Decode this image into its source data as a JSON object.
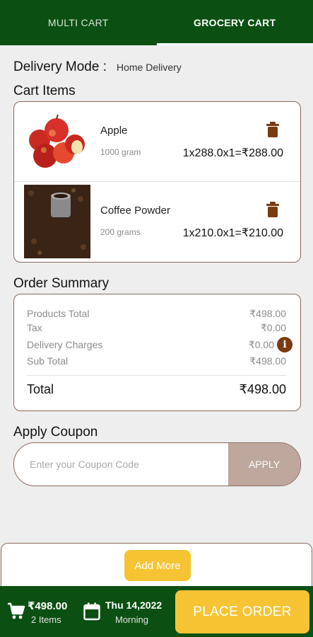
{
  "tabs": [
    {
      "label": "MULTI CART",
      "active": false
    },
    {
      "label": "GROCERY CART",
      "active": true
    }
  ],
  "delivery": {
    "label": "Delivery Mode :",
    "value": "Home Delivery"
  },
  "cart": {
    "title": "Cart Items",
    "items": [
      {
        "name": "Apple",
        "weight": "1000 gram",
        "price": "1x288.0x1=₹288.00",
        "image_icon": "apple-image"
      },
      {
        "name": "Coffee Powder",
        "weight": "200 grams",
        "price": "1x210.0x1=₹210.00",
        "image_icon": "coffee-image"
      }
    ]
  },
  "summary": {
    "title": "Order Summary",
    "rows": [
      {
        "label": "Products Total",
        "value": "₹498.00"
      },
      {
        "label": "Tax",
        "value": "₹0.00"
      },
      {
        "label": "Delivery Charges",
        "value": "₹0.00"
      },
      {
        "label": "Sub Total",
        "value": "₹498.00"
      }
    ],
    "total_label": "Total",
    "total_value": "₹498.00"
  },
  "coupon": {
    "title": "Apply Coupon",
    "placeholder": "Enter your Coupon Code",
    "apply_label": "APPLY"
  },
  "add_more_label": "Add More",
  "bottom": {
    "amount": "₹498.00",
    "items": "2 Items",
    "date": "Thu 14,2022",
    "slot": "Morning",
    "place_order_label": "PLACE ORDER"
  },
  "colors": {
    "primary_green": "#0b5012",
    "accent_yellow": "#f6c433",
    "brown": "#7a3a12",
    "apply_bg": "#bea89d"
  }
}
